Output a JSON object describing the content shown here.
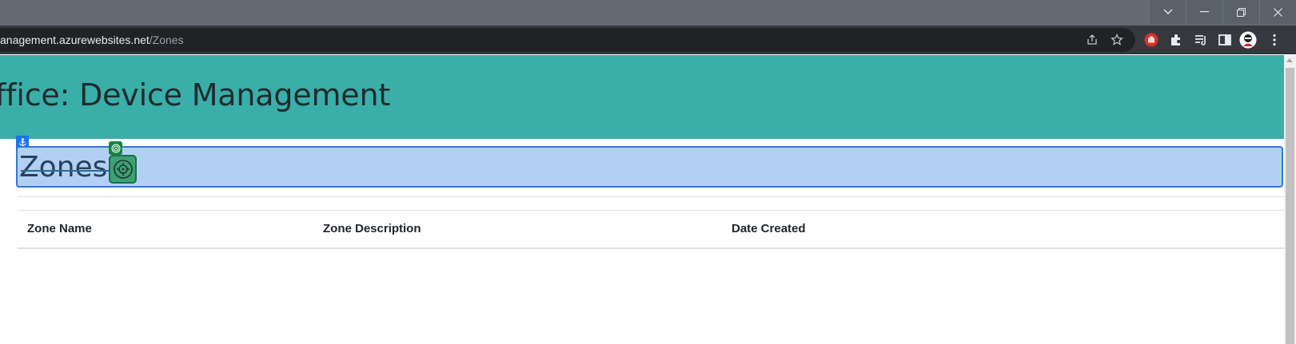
{
  "browser": {
    "url_host": "anagement.azurewebsites.net",
    "url_path": "/Zones",
    "window_controls": [
      "chevron-down-icon",
      "minimize-icon",
      "restore-icon",
      "close-icon"
    ],
    "toolbar_icons": [
      "share-icon",
      "star-icon"
    ],
    "extension_icons": [
      "stop-hand-icon",
      "puzzle-piece-icon",
      "reading-list-icon",
      "side-panel-icon",
      "avatar-icon",
      "more-vertical-icon"
    ]
  },
  "page": {
    "header_title": "ffice: Device Management",
    "section_title": "Zones",
    "table": {
      "columns": [
        "Zone Name",
        "Zone Description",
        "Date Created"
      ],
      "rows": []
    }
  },
  "overlay": {
    "anchor_icon": "anchor-icon",
    "target_icon": "crosshair-icon",
    "highlight_color": "#b2d0f3",
    "highlight_border": "#2f78d6",
    "target_color": "#3f9f75"
  },
  "colors": {
    "header_bg": "#3aaea8",
    "titlebar_bg": "#646b73",
    "toolbar_bg": "#35393d"
  }
}
